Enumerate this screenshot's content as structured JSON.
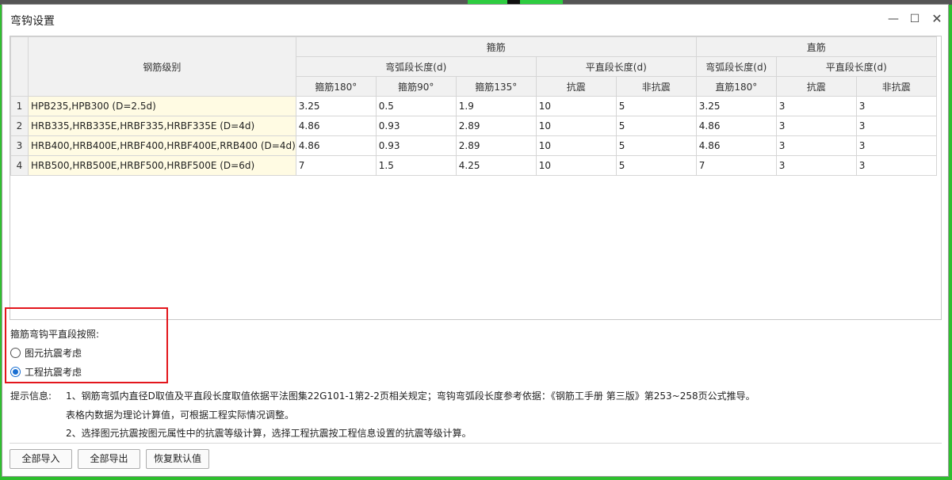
{
  "dialog": {
    "title": "弯钩设置",
    "controls": {
      "minimize": "—",
      "maximize": "☐",
      "close": "✕"
    }
  },
  "table": {
    "header": {
      "grade": "钢筋级别",
      "stirrup_group": "箍筋",
      "straight_group": "直筋",
      "stirrup_arc": "弯弧段长度(d)",
      "stirrup_flat": "平直段长度(d)",
      "straight_arc": "弯弧段长度(d)",
      "straight_flat": "平直段长度(d)",
      "cols": [
        "箍筋180°",
        "箍筋90°",
        "箍筋135°",
        "抗震",
        "非抗震",
        "直筋180°",
        "抗震",
        "非抗震"
      ]
    },
    "rows": [
      {
        "num": "1",
        "grade": "HPB235,HPB300 (D=2.5d)",
        "values": [
          "3.25",
          "0.5",
          "1.9",
          "10",
          "5",
          "3.25",
          "3",
          "3"
        ]
      },
      {
        "num": "2",
        "grade": "HRB335,HRB335E,HRBF335,HRBF335E (D=4d)",
        "values": [
          "4.86",
          "0.93",
          "2.89",
          "10",
          "5",
          "4.86",
          "3",
          "3"
        ]
      },
      {
        "num": "3",
        "grade": "HRB400,HRB400E,HRBF400,HRBF400E,RRB400 (D=4d)",
        "values": [
          "4.86",
          "0.93",
          "2.89",
          "10",
          "5",
          "4.86",
          "3",
          "3"
        ]
      },
      {
        "num": "4",
        "grade": "HRB500,HRB500E,HRBF500,HRBF500E (D=6d)",
        "values": [
          "7",
          "1.5",
          "4.25",
          "10",
          "5",
          "7",
          "3",
          "3"
        ]
      }
    ]
  },
  "options": {
    "title": "箍筋弯钩平直段按照:",
    "items": [
      {
        "label": "图元抗震考虑",
        "checked": false
      },
      {
        "label": "工程抗震考虑",
        "checked": true
      }
    ]
  },
  "hint": {
    "label": "提示信息:",
    "line1": "1、钢筋弯弧内直径D取值及平直段长度取值依据平法图集22G101-1第2-2页相关规定；弯钩弯弧段长度参考依据：《钢筋工手册 第三版》第253~258页公式推导。",
    "line2": "表格内数据为理论计算值，可根据工程实际情况调整。",
    "line3": "2、选择图元抗震按图元属性中的抗震等级计算，选择工程抗震按工程信息设置的抗震等级计算。"
  },
  "buttons": {
    "import_all": "全部导入",
    "export_all": "全部导出",
    "restore_default": "恢复默认值"
  },
  "colors": {
    "highlight": "#e3161c",
    "grade_cell_bg": "#fffbe3",
    "header_bg": "#f1f1f1",
    "radio_accent": "#1a6fd1"
  }
}
